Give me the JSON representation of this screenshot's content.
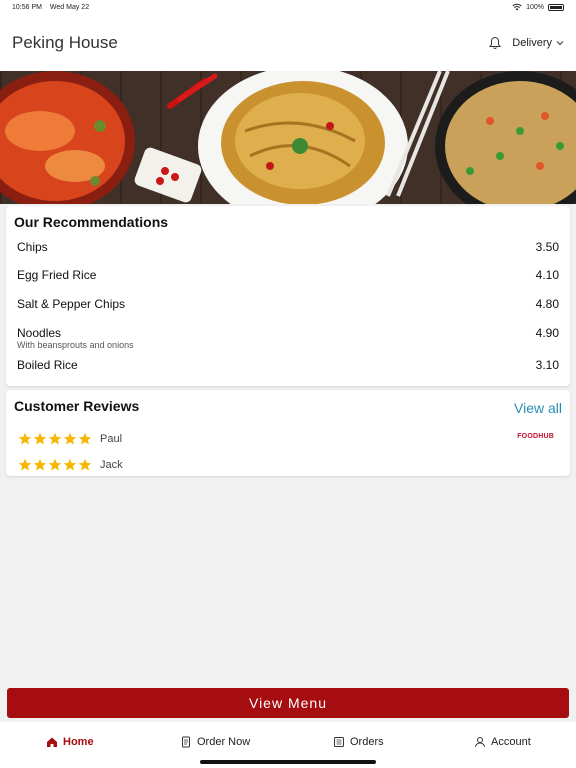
{
  "status": {
    "time": "10:56 PM",
    "date": "Wed May 22",
    "battery": "100%"
  },
  "header": {
    "title": "Peking House",
    "mode": "Delivery"
  },
  "recommendations": {
    "title": "Our Recommendations",
    "items": [
      {
        "name": "Chips",
        "price": "3.50"
      },
      {
        "name": "Egg Fried Rice",
        "price": "4.10"
      },
      {
        "name": "Salt & Pepper Chips",
        "price": "4.80"
      },
      {
        "name": "Noodles",
        "price": "4.90",
        "desc": "With beansprouts and onions"
      },
      {
        "name": "Boiled Rice",
        "price": "3.10"
      }
    ]
  },
  "reviews": {
    "title": "Customer Reviews",
    "view_all": "View all",
    "brand": "FOODHUB",
    "items": [
      {
        "name": "Paul",
        "rating": 5
      },
      {
        "name": "Jack",
        "rating": 5
      }
    ]
  },
  "view_menu": "View Menu",
  "tabs": [
    {
      "label": "Home",
      "icon": "home-icon",
      "active": true
    },
    {
      "label": "Order Now",
      "icon": "order-icon"
    },
    {
      "label": "Orders",
      "icon": "orders-icon"
    },
    {
      "label": "Account",
      "icon": "account-icon"
    }
  ],
  "colors": {
    "accent": "#a50d10",
    "link": "#2a8fb3",
    "star": "#f5b800"
  }
}
